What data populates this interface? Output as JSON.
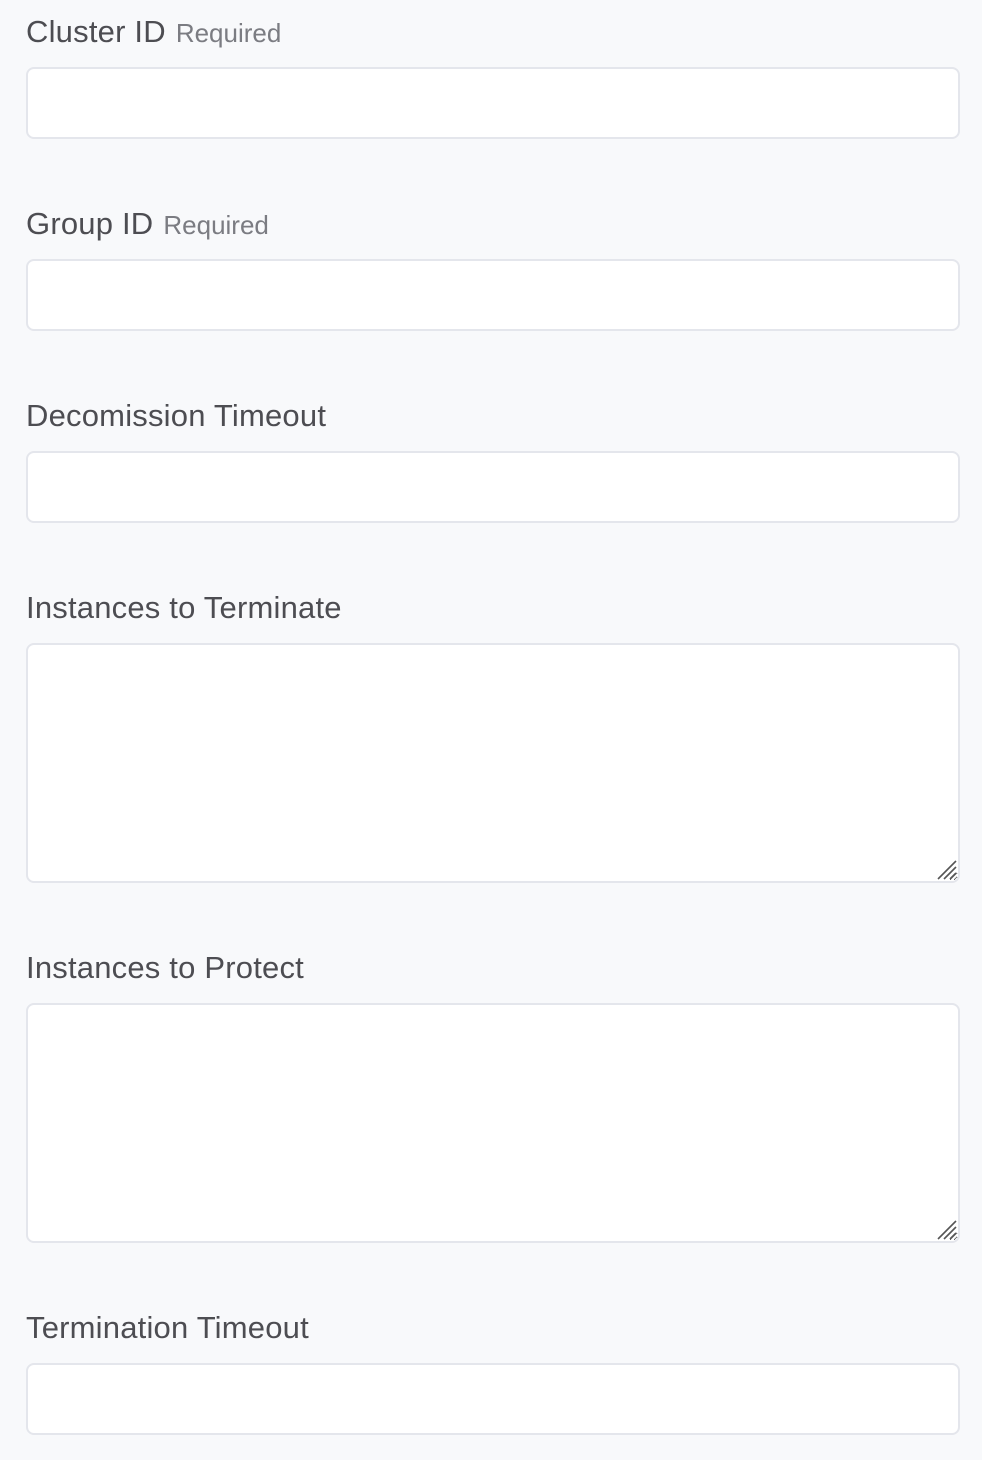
{
  "form": {
    "fields": [
      {
        "label": "Cluster ID",
        "required_text": "Required",
        "value": "",
        "type": "input"
      },
      {
        "label": "Group ID",
        "required_text": "Required",
        "value": "",
        "type": "input"
      },
      {
        "label": "Decomission Timeout",
        "value": "",
        "type": "input"
      },
      {
        "label": "Instances to Terminate",
        "value": "",
        "type": "textarea"
      },
      {
        "label": "Instances to Protect",
        "value": "",
        "type": "textarea"
      },
      {
        "label": "Termination Timeout",
        "value": "",
        "type": "input"
      }
    ]
  },
  "icons": {
    "resize_handle": "resize-grip-icon"
  },
  "colors": {
    "background": "#f8f9fb",
    "field_border": "#e4e6ec",
    "label": "#4d4d52",
    "required": "#7b7c82"
  }
}
